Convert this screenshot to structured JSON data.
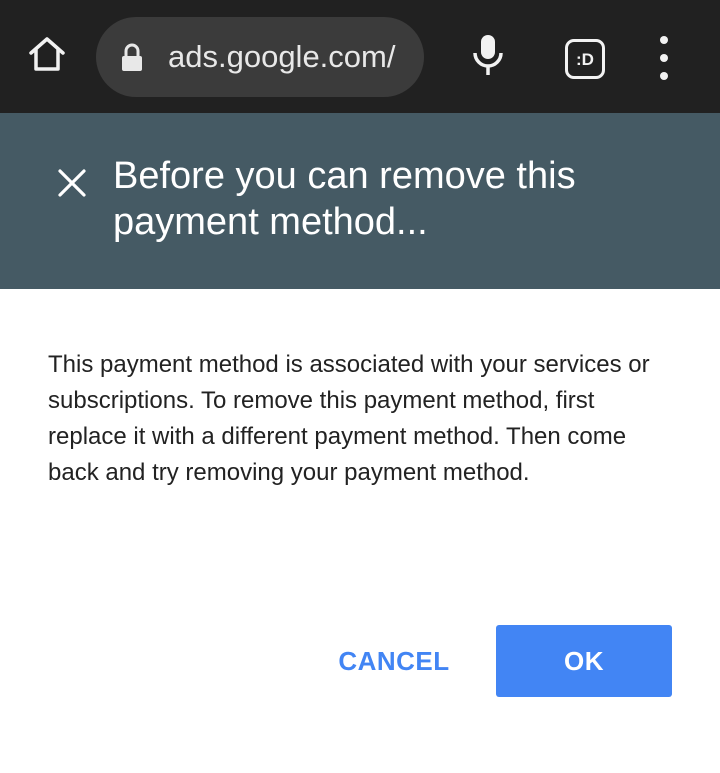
{
  "browser": {
    "url": "ads.google.com/",
    "tab_switcher_label": ":D",
    "icons": {
      "home": "home-icon",
      "lock": "lock-icon",
      "mic": "microphone-icon",
      "menu": "more-vert-icon"
    }
  },
  "dialog": {
    "title": "Before you can remove this payment method...",
    "body": "This payment method is associated with your services or subscriptions. To remove this payment method, first replace it with a different payment method. Then come back and try removing your payment method.",
    "close_icon": "close-icon",
    "cancel_label": "CANCEL",
    "ok_label": "OK"
  },
  "colors": {
    "toolbar_bg": "#212121",
    "url_pill_bg": "#3b3b3b",
    "header_bg": "#455a64",
    "accent": "#4285f4"
  }
}
